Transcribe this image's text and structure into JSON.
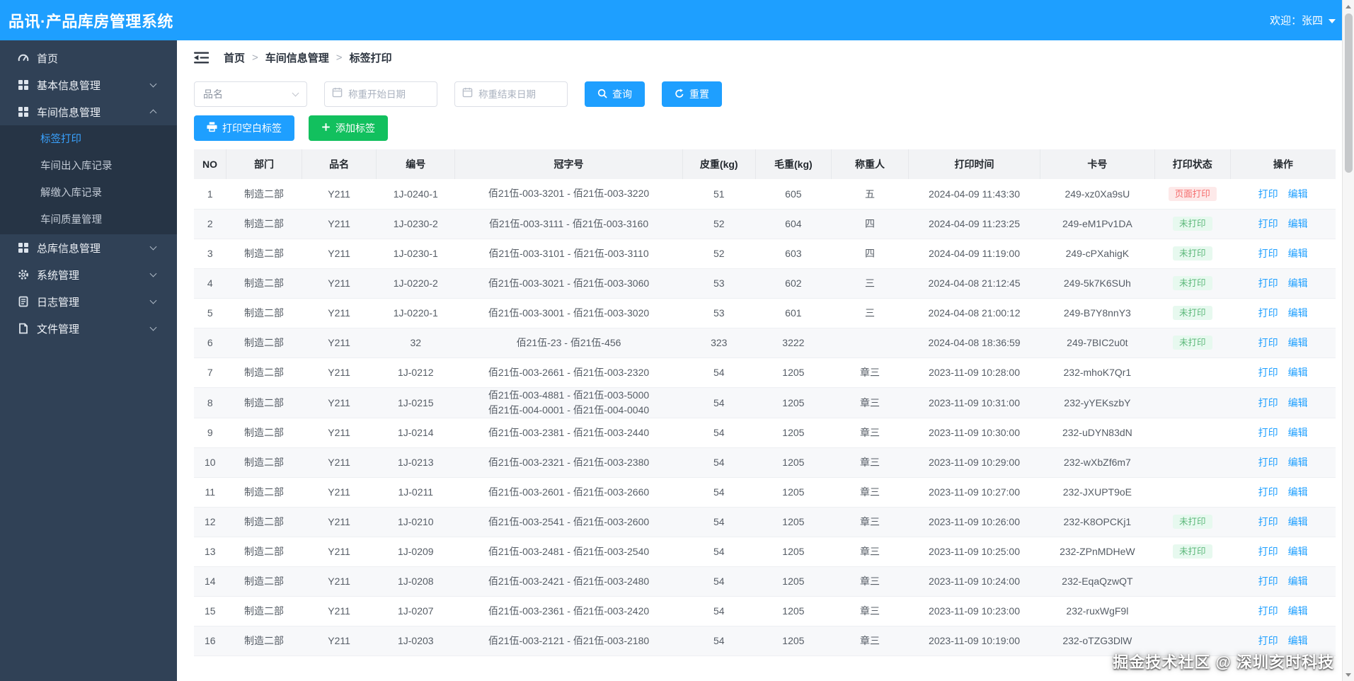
{
  "header": {
    "title": "品讯·产品库房管理系统",
    "welcome": "欢迎：张四"
  },
  "sidebar": {
    "home": "首页",
    "basic_info": "基本信息管理",
    "workshop_info": "车间信息管理",
    "workshop_children": {
      "label_print": "标签打印",
      "in_out_record": "车间出入库记录",
      "turn_in_record": "解缴入库记录",
      "quality": "车间质量管理"
    },
    "warehouse_info": "总库信息管理",
    "system": "系统管理",
    "logs": "日志管理",
    "files": "文件管理"
  },
  "breadcrumb": {
    "home": "首页",
    "section": "车间信息管理",
    "page": "标签打印",
    "separator": ">"
  },
  "filters": {
    "product_placeholder": "品名",
    "date_start_placeholder": "称重开始日期",
    "date_end_placeholder": "称重结束日期",
    "search_label": "查询",
    "reset_label": "重置"
  },
  "actions": {
    "print_blank_label": "打印空白标签",
    "add_label": "添加标签"
  },
  "table": {
    "columns": [
      "NO",
      "部门",
      "品名",
      "编号",
      "冠字号",
      "皮重(kg)",
      "毛重(kg)",
      "称重人",
      "打印时间",
      "卡号",
      "打印状态",
      "操作"
    ],
    "ops": {
      "print": "打印",
      "edit": "编辑"
    },
    "rows": [
      {
        "no": "1",
        "dept": "制造二部",
        "name": "Y211",
        "code": "1J-0240-1",
        "serials": [
          "佰21伍-003-3201 - 佰21伍-003-3220"
        ],
        "tare": "51",
        "gross": "605",
        "weigher": "五",
        "time": "2024-04-09 11:43:30",
        "card": "249-xz0Xa9sU",
        "status": "页面打印",
        "status_type": "danger"
      },
      {
        "no": "2",
        "dept": "制造二部",
        "name": "Y211",
        "code": "1J-0230-2",
        "serials": [
          "佰21伍-003-3111 - 佰21伍-003-3160"
        ],
        "tare": "52",
        "gross": "604",
        "weigher": "四",
        "time": "2024-04-09 11:23:25",
        "card": "249-eM1Pv1DA",
        "status": "未打印",
        "status_type": "success"
      },
      {
        "no": "3",
        "dept": "制造二部",
        "name": "Y211",
        "code": "1J-0230-1",
        "serials": [
          "佰21伍-003-3101 - 佰21伍-003-3110"
        ],
        "tare": "52",
        "gross": "603",
        "weigher": "四",
        "time": "2024-04-09 11:19:00",
        "card": "249-cPXahigK",
        "status": "未打印",
        "status_type": "success"
      },
      {
        "no": "4",
        "dept": "制造二部",
        "name": "Y211",
        "code": "1J-0220-2",
        "serials": [
          "佰21伍-003-3021 - 佰21伍-003-3060"
        ],
        "tare": "53",
        "gross": "602",
        "weigher": "三",
        "time": "2024-04-08 21:12:45",
        "card": "249-5k7K6SUh",
        "status": "未打印",
        "status_type": "success"
      },
      {
        "no": "5",
        "dept": "制造二部",
        "name": "Y211",
        "code": "1J-0220-1",
        "serials": [
          "佰21伍-003-3001 - 佰21伍-003-3020"
        ],
        "tare": "53",
        "gross": "601",
        "weigher": "三",
        "time": "2024-04-08 21:00:12",
        "card": "249-B7Y8nnY3",
        "status": "未打印",
        "status_type": "success"
      },
      {
        "no": "6",
        "dept": "制造二部",
        "name": "Y211",
        "code": "32",
        "serials": [
          "佰21伍-23 - 佰21伍-456"
        ],
        "tare": "323",
        "gross": "3222",
        "weigher": "",
        "time": "2024-04-08 18:36:59",
        "card": "249-7BIC2u0t",
        "status": "未打印",
        "status_type": "success"
      },
      {
        "no": "7",
        "dept": "制造二部",
        "name": "Y211",
        "code": "1J-0212",
        "serials": [
          "佰21伍-003-2661 - 佰21伍-003-2320"
        ],
        "tare": "54",
        "gross": "1205",
        "weigher": "章三",
        "time": "2023-11-09 10:28:00",
        "card": "232-mhoK7Qr1",
        "status": "",
        "status_type": ""
      },
      {
        "no": "8",
        "dept": "制造二部",
        "name": "Y211",
        "code": "1J-0215",
        "serials": [
          "佰21伍-003-4881 - 佰21伍-003-5000",
          "佰21伍-004-0001 - 佰21伍-004-0040"
        ],
        "tare": "54",
        "gross": "1205",
        "weigher": "章三",
        "time": "2023-11-09 10:31:00",
        "card": "232-yYEKszbY",
        "status": "",
        "status_type": ""
      },
      {
        "no": "9",
        "dept": "制造二部",
        "name": "Y211",
        "code": "1J-0214",
        "serials": [
          "佰21伍-003-2381 - 佰21伍-003-2440"
        ],
        "tare": "54",
        "gross": "1205",
        "weigher": "章三",
        "time": "2023-11-09 10:30:00",
        "card": "232-uDYN83dN",
        "status": "",
        "status_type": ""
      },
      {
        "no": "10",
        "dept": "制造二部",
        "name": "Y211",
        "code": "1J-0213",
        "serials": [
          "佰21伍-003-2321 - 佰21伍-003-2380"
        ],
        "tare": "54",
        "gross": "1205",
        "weigher": "章三",
        "time": "2023-11-09 10:29:00",
        "card": "232-wXbZf6m7",
        "status": "",
        "status_type": ""
      },
      {
        "no": "11",
        "dept": "制造二部",
        "name": "Y211",
        "code": "1J-0211",
        "serials": [
          "佰21伍-003-2601 - 佰21伍-003-2660"
        ],
        "tare": "54",
        "gross": "1205",
        "weigher": "章三",
        "time": "2023-11-09 10:27:00",
        "card": "232-JXUPT9oE",
        "status": "",
        "status_type": ""
      },
      {
        "no": "12",
        "dept": "制造二部",
        "name": "Y211",
        "code": "1J-0210",
        "serials": [
          "佰21伍-003-2541 - 佰21伍-003-2600"
        ],
        "tare": "54",
        "gross": "1205",
        "weigher": "章三",
        "time": "2023-11-09 10:26:00",
        "card": "232-K8OPCKj1",
        "status": "未打印",
        "status_type": "success"
      },
      {
        "no": "13",
        "dept": "制造二部",
        "name": "Y211",
        "code": "1J-0209",
        "serials": [
          "佰21伍-003-2481 - 佰21伍-003-2540"
        ],
        "tare": "54",
        "gross": "1205",
        "weigher": "章三",
        "time": "2023-11-09 10:25:00",
        "card": "232-ZPnMDHeW",
        "status": "未打印",
        "status_type": "success"
      },
      {
        "no": "14",
        "dept": "制造二部",
        "name": "Y211",
        "code": "1J-0208",
        "serials": [
          "佰21伍-003-2421 - 佰21伍-003-2480"
        ],
        "tare": "54",
        "gross": "1205",
        "weigher": "章三",
        "time": "2023-11-09 10:24:00",
        "card": "232-EqaQzwQT",
        "status": "",
        "status_type": ""
      },
      {
        "no": "15",
        "dept": "制造二部",
        "name": "Y211",
        "code": "1J-0207",
        "serials": [
          "佰21伍-003-2361 - 佰21伍-003-2420"
        ],
        "tare": "54",
        "gross": "1205",
        "weigher": "章三",
        "time": "2023-11-09 10:23:00",
        "card": "232-ruxWgF9l",
        "status": "",
        "status_type": ""
      },
      {
        "no": "16",
        "dept": "制造二部",
        "name": "Y211",
        "code": "1J-0203",
        "serials": [
          "佰21伍-003-2121 - 佰21伍-003-2180"
        ],
        "tare": "54",
        "gross": "1205",
        "weigher": "章三",
        "time": "2023-11-09 10:19:00",
        "card": "232-oTZG3DlW",
        "status": "",
        "status_type": ""
      }
    ]
  },
  "watermark": "掘金技术社区 @ 深圳亥时科技",
  "colors": {
    "header_blue": "#1E9FFF",
    "sidebar_bg": "#304156",
    "submenu_bg": "#263445",
    "active_menu_link": "#39A2FF",
    "button_green": "#12C05E",
    "badge_success": "#5CB87A",
    "badge_danger": "#F56C6C"
  },
  "icons": {
    "dashboard-icon": "gauge",
    "grid-icon": "four-squares",
    "gear-icon": "gear",
    "log-icon": "notebook-lines",
    "file-icon": "document",
    "chevron-down-icon": "chevron-down",
    "chevron-up-icon": "chevron-up",
    "hamburger-fold-icon": "three-bars-with-left-arrow",
    "search-icon": "magnifier",
    "reset-icon": "circular-arrow",
    "printer-icon": "printer",
    "plus-icon": "plus",
    "calendar-icon": "calendar",
    "caret-down-icon": "triangle-down"
  }
}
